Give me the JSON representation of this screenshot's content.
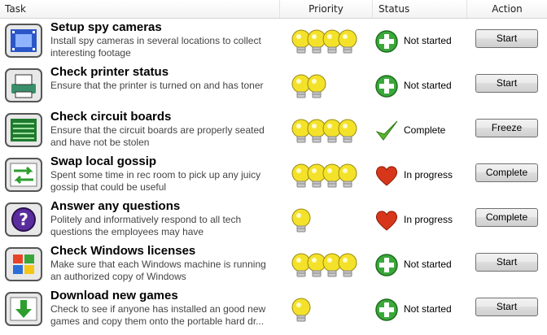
{
  "header": {
    "task": "Task",
    "priority": "Priority",
    "status": "Status",
    "action": "Action"
  },
  "tasks": [
    {
      "icon": "film-strip-icon",
      "title": "Setup spy cameras",
      "desc": "Install spy cameras in several locations to collect interesting footage",
      "priority": 4,
      "status": "Not started",
      "status_icon": "plus-icon",
      "action": "Start"
    },
    {
      "icon": "printer-icon",
      "title": "Check printer status",
      "desc": "Ensure that the printer is turned on and has toner",
      "priority": 2,
      "status": "Not started",
      "status_icon": "plus-icon",
      "action": "Start"
    },
    {
      "icon": "circuit-board-icon",
      "title": "Check circuit boards",
      "desc": "Ensure that the circuit boards are properly seated and have not be stolen",
      "priority": 4,
      "status": "Complete",
      "status_icon": "checkmark-icon",
      "action": "Freeze"
    },
    {
      "icon": "swap-arrows-icon",
      "title": "Swap local gossip",
      "desc": "Spent some time in rec room to pick up any juicy gossip that could be useful",
      "priority": 4,
      "status": "In progress",
      "status_icon": "heart-icon",
      "action": "Complete"
    },
    {
      "icon": "question-mark-icon",
      "title": "Answer any questions",
      "desc": "Politely and informatively respond to all tech questions the employees may have",
      "priority": 1,
      "status": "In progress",
      "status_icon": "heart-icon",
      "action": "Complete"
    },
    {
      "icon": "windows-logo-icon",
      "title": "Check Windows licenses",
      "desc": "Make sure that each Windows machine is running an authorized copy of Windows",
      "priority": 4,
      "status": "Not started",
      "status_icon": "plus-icon",
      "action": "Start"
    },
    {
      "icon": "download-arrow-icon",
      "title": "Download new games",
      "desc": "Check to see if anyone has installed an good new games and copy them onto the portable hard dr...",
      "priority": 1,
      "status": "Not started",
      "status_icon": "plus-icon",
      "action": "Start"
    }
  ],
  "colors": {
    "bulb": "#f4e22a",
    "plus": "#3aa83a",
    "check": "#5cb82a",
    "heart": "#d8361a"
  }
}
